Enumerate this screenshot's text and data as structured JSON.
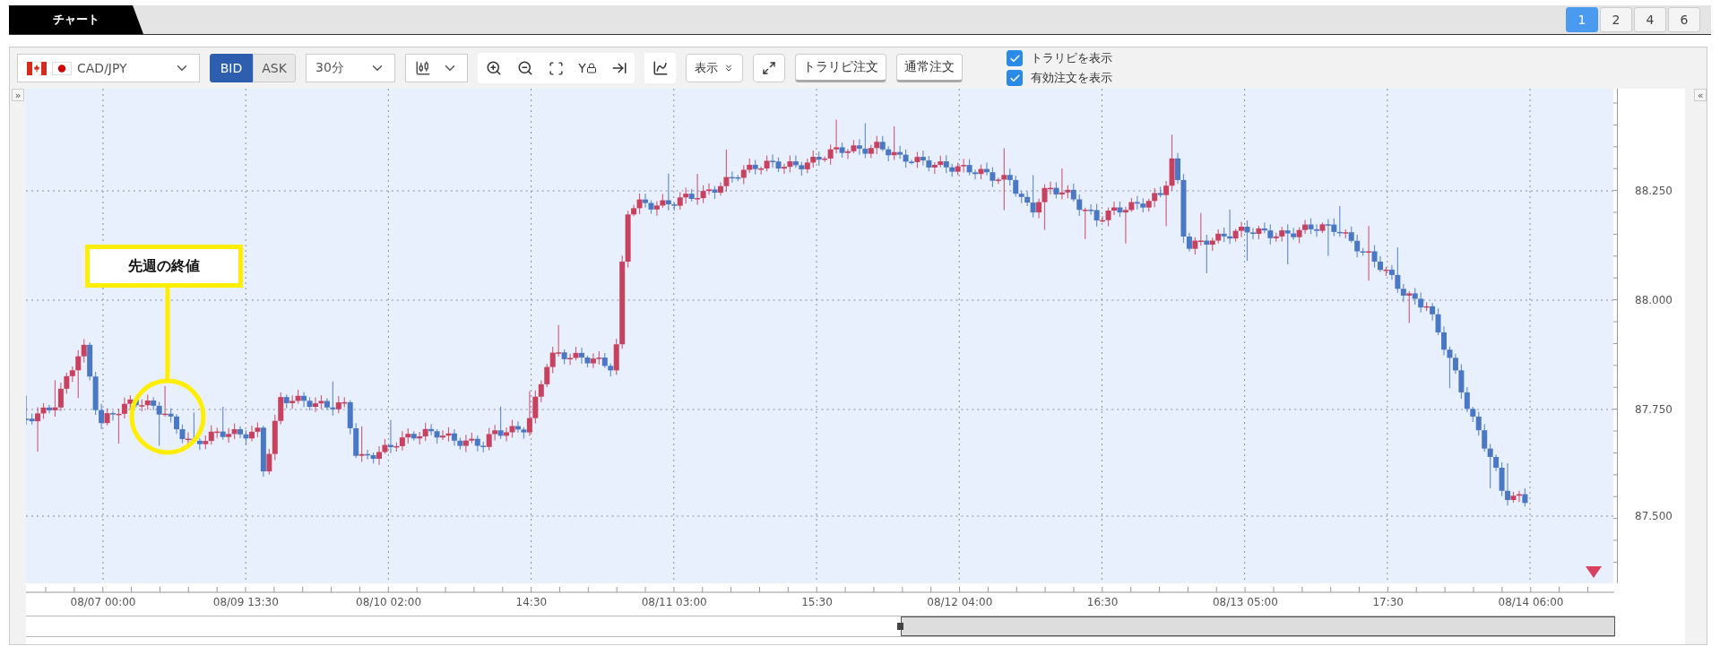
{
  "tab": {
    "label": "チャート"
  },
  "layouts": [
    {
      "label": "1",
      "selected": true
    },
    {
      "label": "2",
      "selected": false
    },
    {
      "label": "4",
      "selected": false
    },
    {
      "label": "6",
      "selected": false
    }
  ],
  "toolbar": {
    "symbol": "CAD/JPY",
    "price_side": [
      {
        "label": "BID",
        "selected": true
      },
      {
        "label": "ASK",
        "selected": false
      }
    ],
    "timeframe": "30分",
    "y_lock_label": "Y",
    "display_button": "表示",
    "order_buttons": [
      "トラリピ注文",
      "通常注文"
    ],
    "checkboxes": [
      {
        "label": "トラリピを表示",
        "checked": true
      },
      {
        "label": "有効注文を表示",
        "checked": true
      }
    ]
  },
  "collapse_left": "»",
  "collapse_right": "«",
  "chart": {
    "price_ticks": [
      "88.250",
      "88.000",
      "87.750",
      "87.500"
    ],
    "time_ticks": [
      "08/07 00:00",
      "08/09 13:30",
      "08/10 02:00",
      "14:30",
      "08/11 03:00",
      "15:30",
      "08/12 04:00",
      "16:30",
      "08/13 05:00",
      "17:30",
      "08/14 06:00"
    ],
    "annotation": "先週の終値"
  }
}
